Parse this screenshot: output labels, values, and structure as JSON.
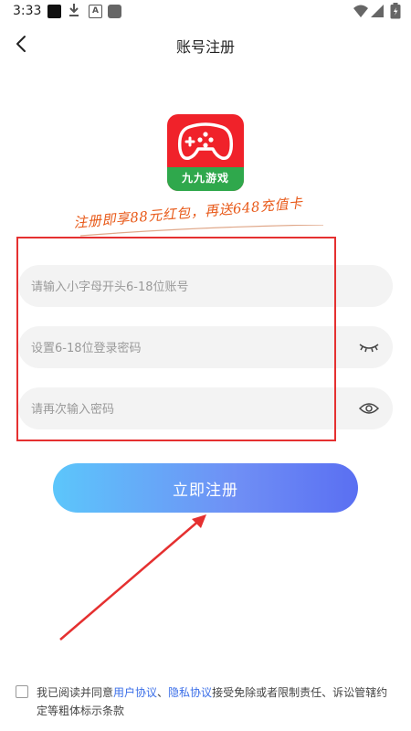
{
  "status_bar": {
    "time": "3:33"
  },
  "header": {
    "title": "账号注册"
  },
  "logo": {
    "text": "九九游戏"
  },
  "promo": {
    "text": "注册即享88元红包，再送648充值卡"
  },
  "form": {
    "account_placeholder": "请输入小字母开头6-18位账号",
    "password_placeholder": "设置6-18位登录密码",
    "confirm_placeholder": "请再次输入密码"
  },
  "register_button": {
    "label": "立即注册"
  },
  "agreement": {
    "prefix": "我已阅读并同意",
    "user_agreement": "用户协议",
    "separator": "、",
    "privacy_agreement": "隐私协议",
    "suffix": "接受免除或者限制责任、诉讼管辖约定等粗体标示条款"
  },
  "colors": {
    "accent_red": "#e53030",
    "button_start": "#5cc6fb",
    "button_end": "#5a6ff2",
    "link": "#3a6ee8",
    "promo": "#e85a1a"
  }
}
